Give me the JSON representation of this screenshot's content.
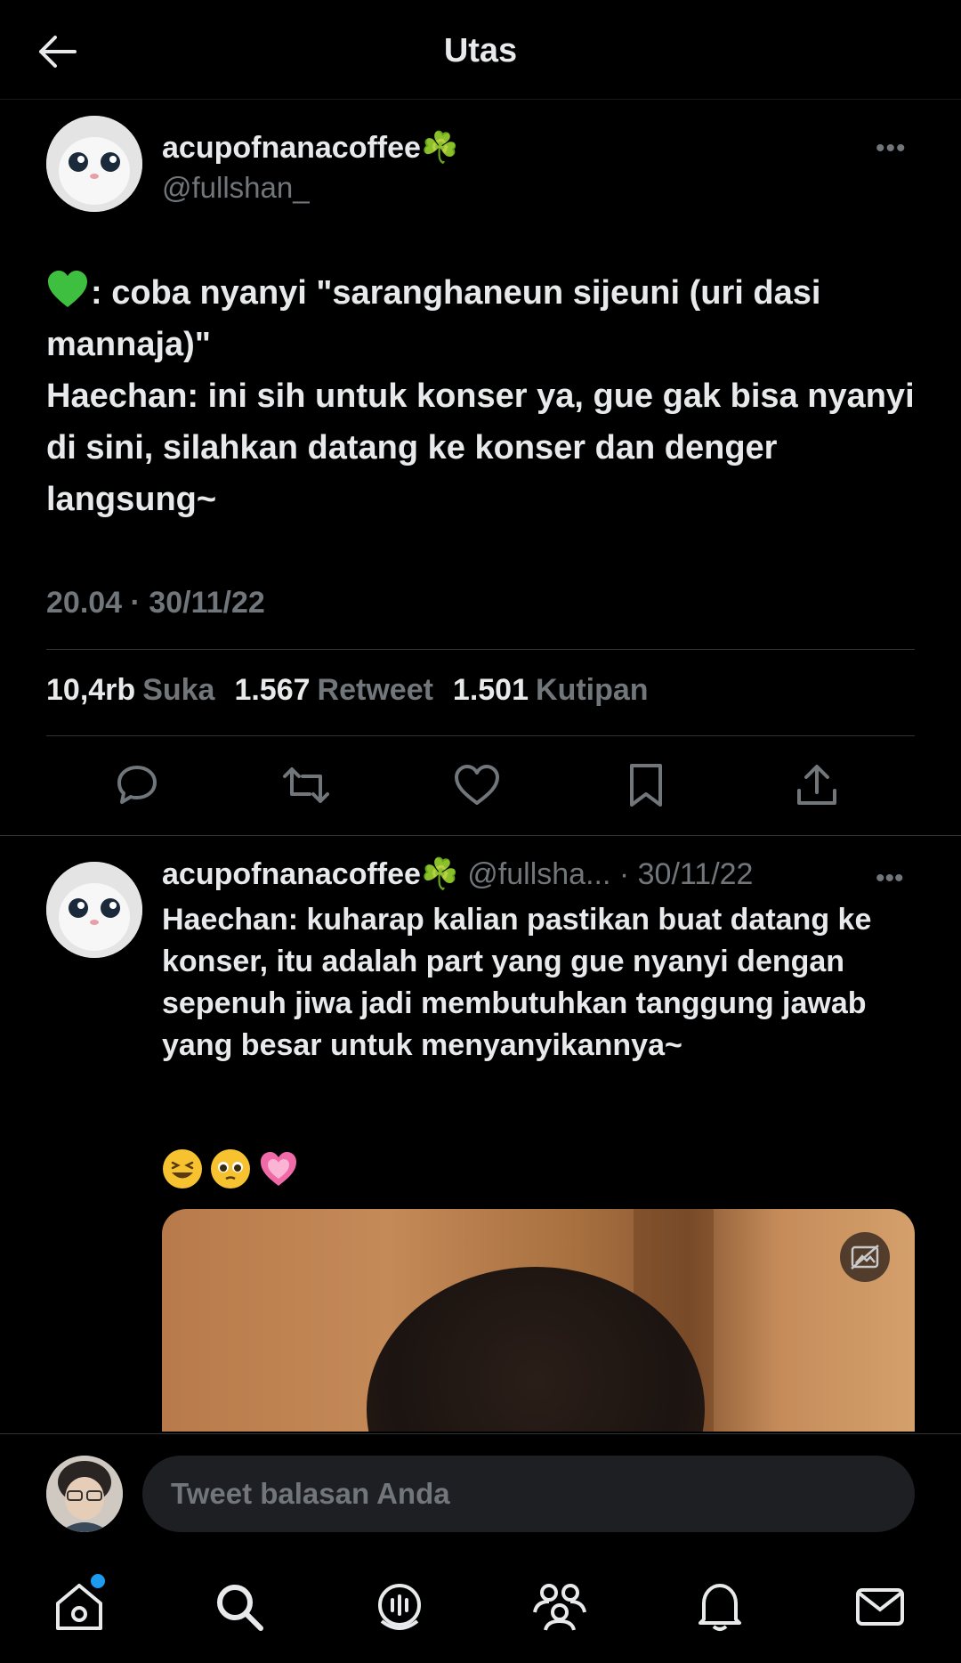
{
  "header": {
    "title": "Utas"
  },
  "main_tweet": {
    "display_name": "acupofnanacoffee☘️",
    "handle": "@fullshan_",
    "text_lines": [
      ": coba nyanyi \"saranghaneun sijeuni (uri dasi mannaja)\"",
      "Haechan: ini sih untuk konser ya, gue gak bisa nyanyi di sini, silahkan datang ke konser dan denger langsung~"
    ],
    "timestamp": "20.04 · 30/11/22",
    "stats": {
      "likes_count": "10,4rb",
      "likes_label": "Suka",
      "retweets_count": "1.567",
      "retweets_label": "Retweet",
      "quotes_count": "1.501",
      "quotes_label": "Kutipan"
    }
  },
  "reply_tweet": {
    "display_name": "acupofnanacoffee☘️",
    "handle_time": "@fullsha... · 30/11/22",
    "text": "Haechan: kuharap kalian pastikan buat datang ke konser, itu adalah part yang gue nyanyi dengan sepenuh jiwa jadi membutuhkan tanggung jawab yang besar untuk menyanyikannya~",
    "emojis": [
      "😆",
      "🥹",
      "💗"
    ]
  },
  "composer": {
    "placeholder": "Tweet balasan Anda"
  },
  "colors": {
    "background": "#000000",
    "text": "#e7e9ea",
    "muted": "#71767b",
    "accent": "#1d9bf0",
    "heart_emoji": "#3fbf3f"
  },
  "icons": {
    "header": "back-arrow-icon",
    "actions": [
      "reply-icon",
      "retweet-icon",
      "like-icon",
      "bookmark-icon",
      "share-icon"
    ],
    "nav": [
      "home-icon",
      "search-icon",
      "spaces-icon",
      "communities-icon",
      "notifications-icon",
      "messages-icon"
    ]
  }
}
